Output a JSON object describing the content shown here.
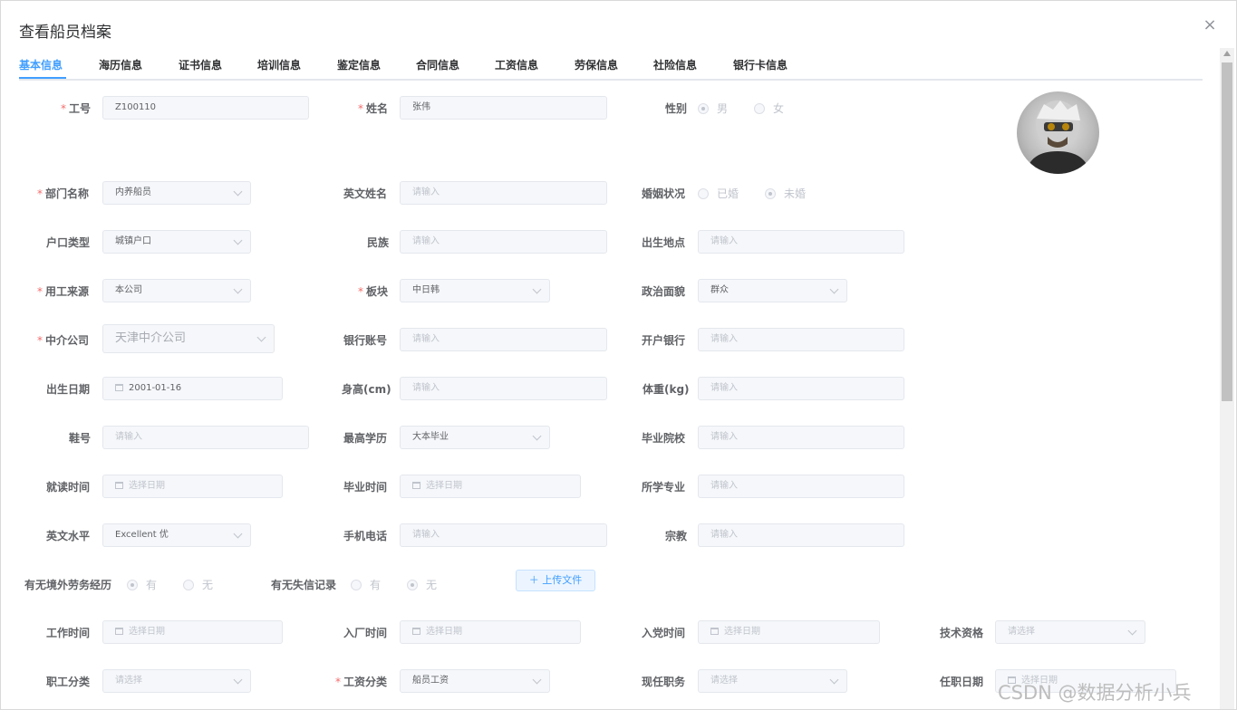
{
  "dialog": {
    "title": "查看船员档案",
    "close_icon": "×"
  },
  "tabs": [
    "基本信息",
    "海历信息",
    "证书信息",
    "培训信息",
    "鉴定信息",
    "合同信息",
    "工资信息",
    "劳保信息",
    "社险信息",
    "银行卡信息"
  ],
  "form": {
    "employee_no": {
      "label": "工号",
      "value": "Z100110"
    },
    "name": {
      "label": "姓名",
      "value": "张伟"
    },
    "gender": {
      "label": "性别",
      "options": [
        "男",
        "女"
      ],
      "selected": "男"
    },
    "dept": {
      "label": "部门名称",
      "value": "内养船员"
    },
    "english_name": {
      "label": "英文姓名",
      "placeholder": "请输入"
    },
    "marital": {
      "label": "婚姻状况",
      "options": [
        "已婚",
        "未婚"
      ],
      "selected": "未婚"
    },
    "hukou_type": {
      "label": "户口类型",
      "value": "城镇户口"
    },
    "ethnicity": {
      "label": "民族",
      "placeholder": "请输入"
    },
    "birthplace": {
      "label": "出生地点",
      "placeholder": "请输入"
    },
    "employment_source": {
      "label": "用工来源",
      "value": "本公司"
    },
    "sector": {
      "label": "板块",
      "value": "中日韩"
    },
    "political_status": {
      "label": "政治面貌",
      "value": "群众"
    },
    "agency": {
      "label": "中介公司",
      "value": "天津中介公司"
    },
    "bank_account": {
      "label": "银行账号",
      "placeholder": "请输入"
    },
    "bank": {
      "label": "开户银行",
      "placeholder": "请输入"
    },
    "birth_date": {
      "label": "出生日期",
      "value": "2001-01-16"
    },
    "height": {
      "label": "身高(cm)",
      "placeholder": "请输入"
    },
    "weight": {
      "label": "体重(kg)",
      "placeholder": "请输入"
    },
    "shoe_size": {
      "label": "鞋号",
      "placeholder": "请输入"
    },
    "education": {
      "label": "最高学历",
      "value": "大本毕业"
    },
    "school": {
      "label": "毕业院校",
      "placeholder": "请输入"
    },
    "study_time": {
      "label": "就读时间",
      "placeholder": "选择日期"
    },
    "grad_time": {
      "label": "毕业时间",
      "placeholder": "选择日期"
    },
    "major": {
      "label": "所学专业",
      "placeholder": "请输入"
    },
    "english_level": {
      "label": "英文水平",
      "value": "Excellent 优"
    },
    "mobile": {
      "label": "手机电话",
      "placeholder": "请输入"
    },
    "religion": {
      "label": "宗教",
      "placeholder": "请输入"
    },
    "overseas_labor": {
      "label": "有无境外劳务经历",
      "options": [
        "有",
        "无"
      ],
      "selected": "有"
    },
    "dishonesty": {
      "label": "有无失信记录",
      "options": [
        "有",
        "无"
      ],
      "selected": "无"
    },
    "upload_label": "上传文件",
    "work_time": {
      "label": "工作时间",
      "placeholder": "选择日期"
    },
    "factory_time": {
      "label": "入厂时间",
      "placeholder": "选择日期"
    },
    "party_time": {
      "label": "入党时间",
      "placeholder": "选择日期"
    },
    "tech_qualification": {
      "label": "技术资格",
      "placeholder": "请选择"
    },
    "staff_category": {
      "label": "职工分类",
      "placeholder": "请选择"
    },
    "salary_category": {
      "label": "工资分类",
      "value": "船员工资"
    },
    "current_position": {
      "label": "现任职务",
      "placeholder": "请选择"
    },
    "appoint_date": {
      "label": "任职日期",
      "placeholder": "选择日期"
    }
  },
  "watermark": "CSDN @数据分析小兵",
  "colors": {
    "accent": "#409eff",
    "required": "#f56c6c",
    "input_bg": "#f5f7fa"
  }
}
